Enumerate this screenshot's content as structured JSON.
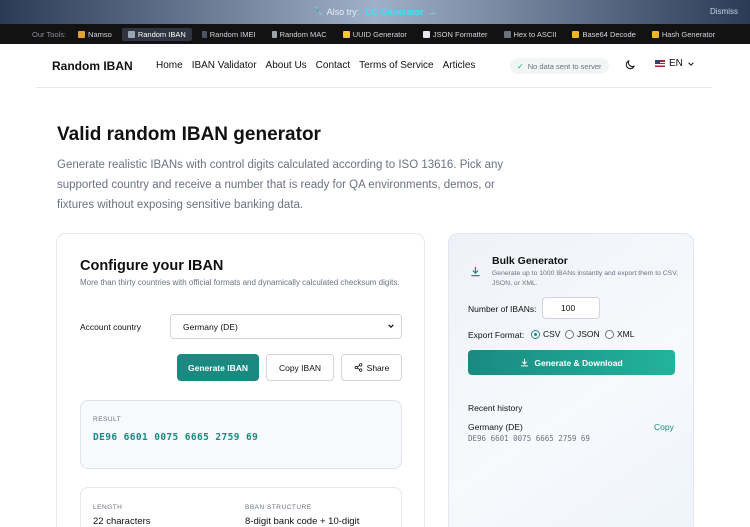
{
  "promo": {
    "also_label": "Also try:",
    "link": "CC Generator",
    "arrow": "→",
    "dismiss": "Dismiss"
  },
  "tools": {
    "label": "Our Tools:",
    "items": [
      {
        "name": "Namso",
        "icon": "namso-icon"
      },
      {
        "name": "Random IBAN",
        "icon": "bank-icon",
        "active": true
      },
      {
        "name": "Random IMEI",
        "icon": "phone-icon"
      },
      {
        "name": "Random MAC",
        "icon": "wrench-icon"
      },
      {
        "name": "UUID Generator",
        "icon": "key-icon"
      },
      {
        "name": "JSON Formatter",
        "icon": "clipboard-icon"
      },
      {
        "name": "Hex to ASCII",
        "icon": "hex-icon"
      },
      {
        "name": "Base64 Decode",
        "icon": "lock-icon"
      },
      {
        "name": "Hash Generator",
        "icon": "lock-icon"
      }
    ]
  },
  "header": {
    "brand": "Random IBAN",
    "nav": [
      "Home",
      "IBAN Validator",
      "About Us",
      "Contact",
      "Terms of Service",
      "Articles"
    ],
    "privacy": "No data sent to server",
    "language": "EN"
  },
  "hero": {
    "title": "Valid random IBAN generator",
    "description": "Generate realistic IBANs with control digits calculated according to ISO 13616. Pick any supported country and receive a number that is ready for QA environments, demos, or fixtures without exposing sensitive banking data."
  },
  "config": {
    "title": "Configure your IBAN",
    "subtitle": "More than thirty countries with official formats and dynamically calculated checksum digits.",
    "country_label": "Account country",
    "country_value": "Germany (DE)",
    "generate_label": "Generate IBAN",
    "copy_label": "Copy IBAN",
    "share_label": "Share",
    "result_label": "RESULT",
    "result_value": "DE96 6601 0075 6665 2759 69",
    "length_label": "LENGTH",
    "length_value": "22 characters",
    "bban_label": "BBAN STRUCTURE",
    "bban_value": "8-digit bank code + 10-digit"
  },
  "bulk": {
    "title": "Bulk Generator",
    "subtitle": "Generate up to 1000 IBANs instantly and export them to CSV, JSON, or XML.",
    "count_label": "Number of IBANs:",
    "count_value": "100",
    "format_label": "Export Format:",
    "formats": [
      "CSV",
      "JSON",
      "XML"
    ],
    "selected_format": "CSV",
    "button_label": "Generate & Download",
    "history_title": "Recent history",
    "history_country": "Germany (DE)",
    "history_iban": "DE96 6601 0075 6665 2759 69",
    "history_copy": "Copy"
  },
  "colors": {
    "accent": "#1a8a80",
    "tools_bg": "#121212"
  }
}
